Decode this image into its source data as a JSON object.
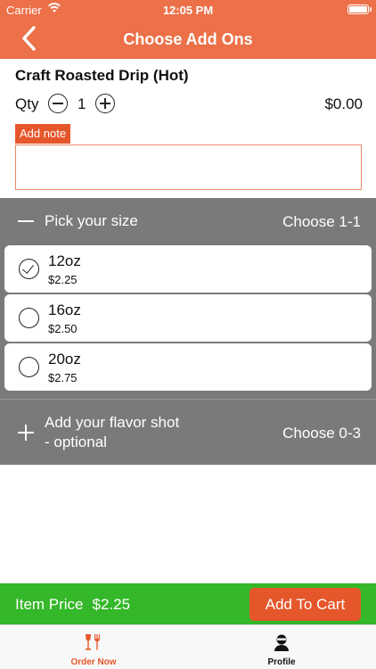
{
  "status_bar": {
    "carrier": "Carrier",
    "time": "12:05 PM"
  },
  "nav": {
    "title": "Choose Add Ons"
  },
  "product": {
    "name": "Craft Roasted Drip (Hot)",
    "qty_label": "Qty",
    "qty": "1",
    "price": "$0.00"
  },
  "note": {
    "label": "Add note",
    "value": ""
  },
  "groups": [
    {
      "title": "Pick your size",
      "choose": "Choose 1-1",
      "expanded": true,
      "options": [
        {
          "name": "12oz",
          "price": "$2.25",
          "selected": true
        },
        {
          "name": "16oz",
          "price": "$2.50",
          "selected": false
        },
        {
          "name": "20oz",
          "price": "$2.75",
          "selected": false
        }
      ]
    },
    {
      "title_line1": "Add your flavor shot",
      "title_line2": "- optional",
      "choose": "Choose 0-3",
      "expanded": false
    }
  ],
  "cart": {
    "item_price_label": "Item Price",
    "item_price": "$2.25",
    "add_button": "Add To Cart"
  },
  "tabs": [
    {
      "label": "Order Now",
      "icon": "utensils-icon",
      "active": true
    },
    {
      "label": "Profile",
      "icon": "person-icon",
      "active": false
    }
  ],
  "colors": {
    "brand": "#ec7048",
    "accent": "#e5572b",
    "group": "#7a7a7a",
    "cart_bar": "#34b728"
  }
}
